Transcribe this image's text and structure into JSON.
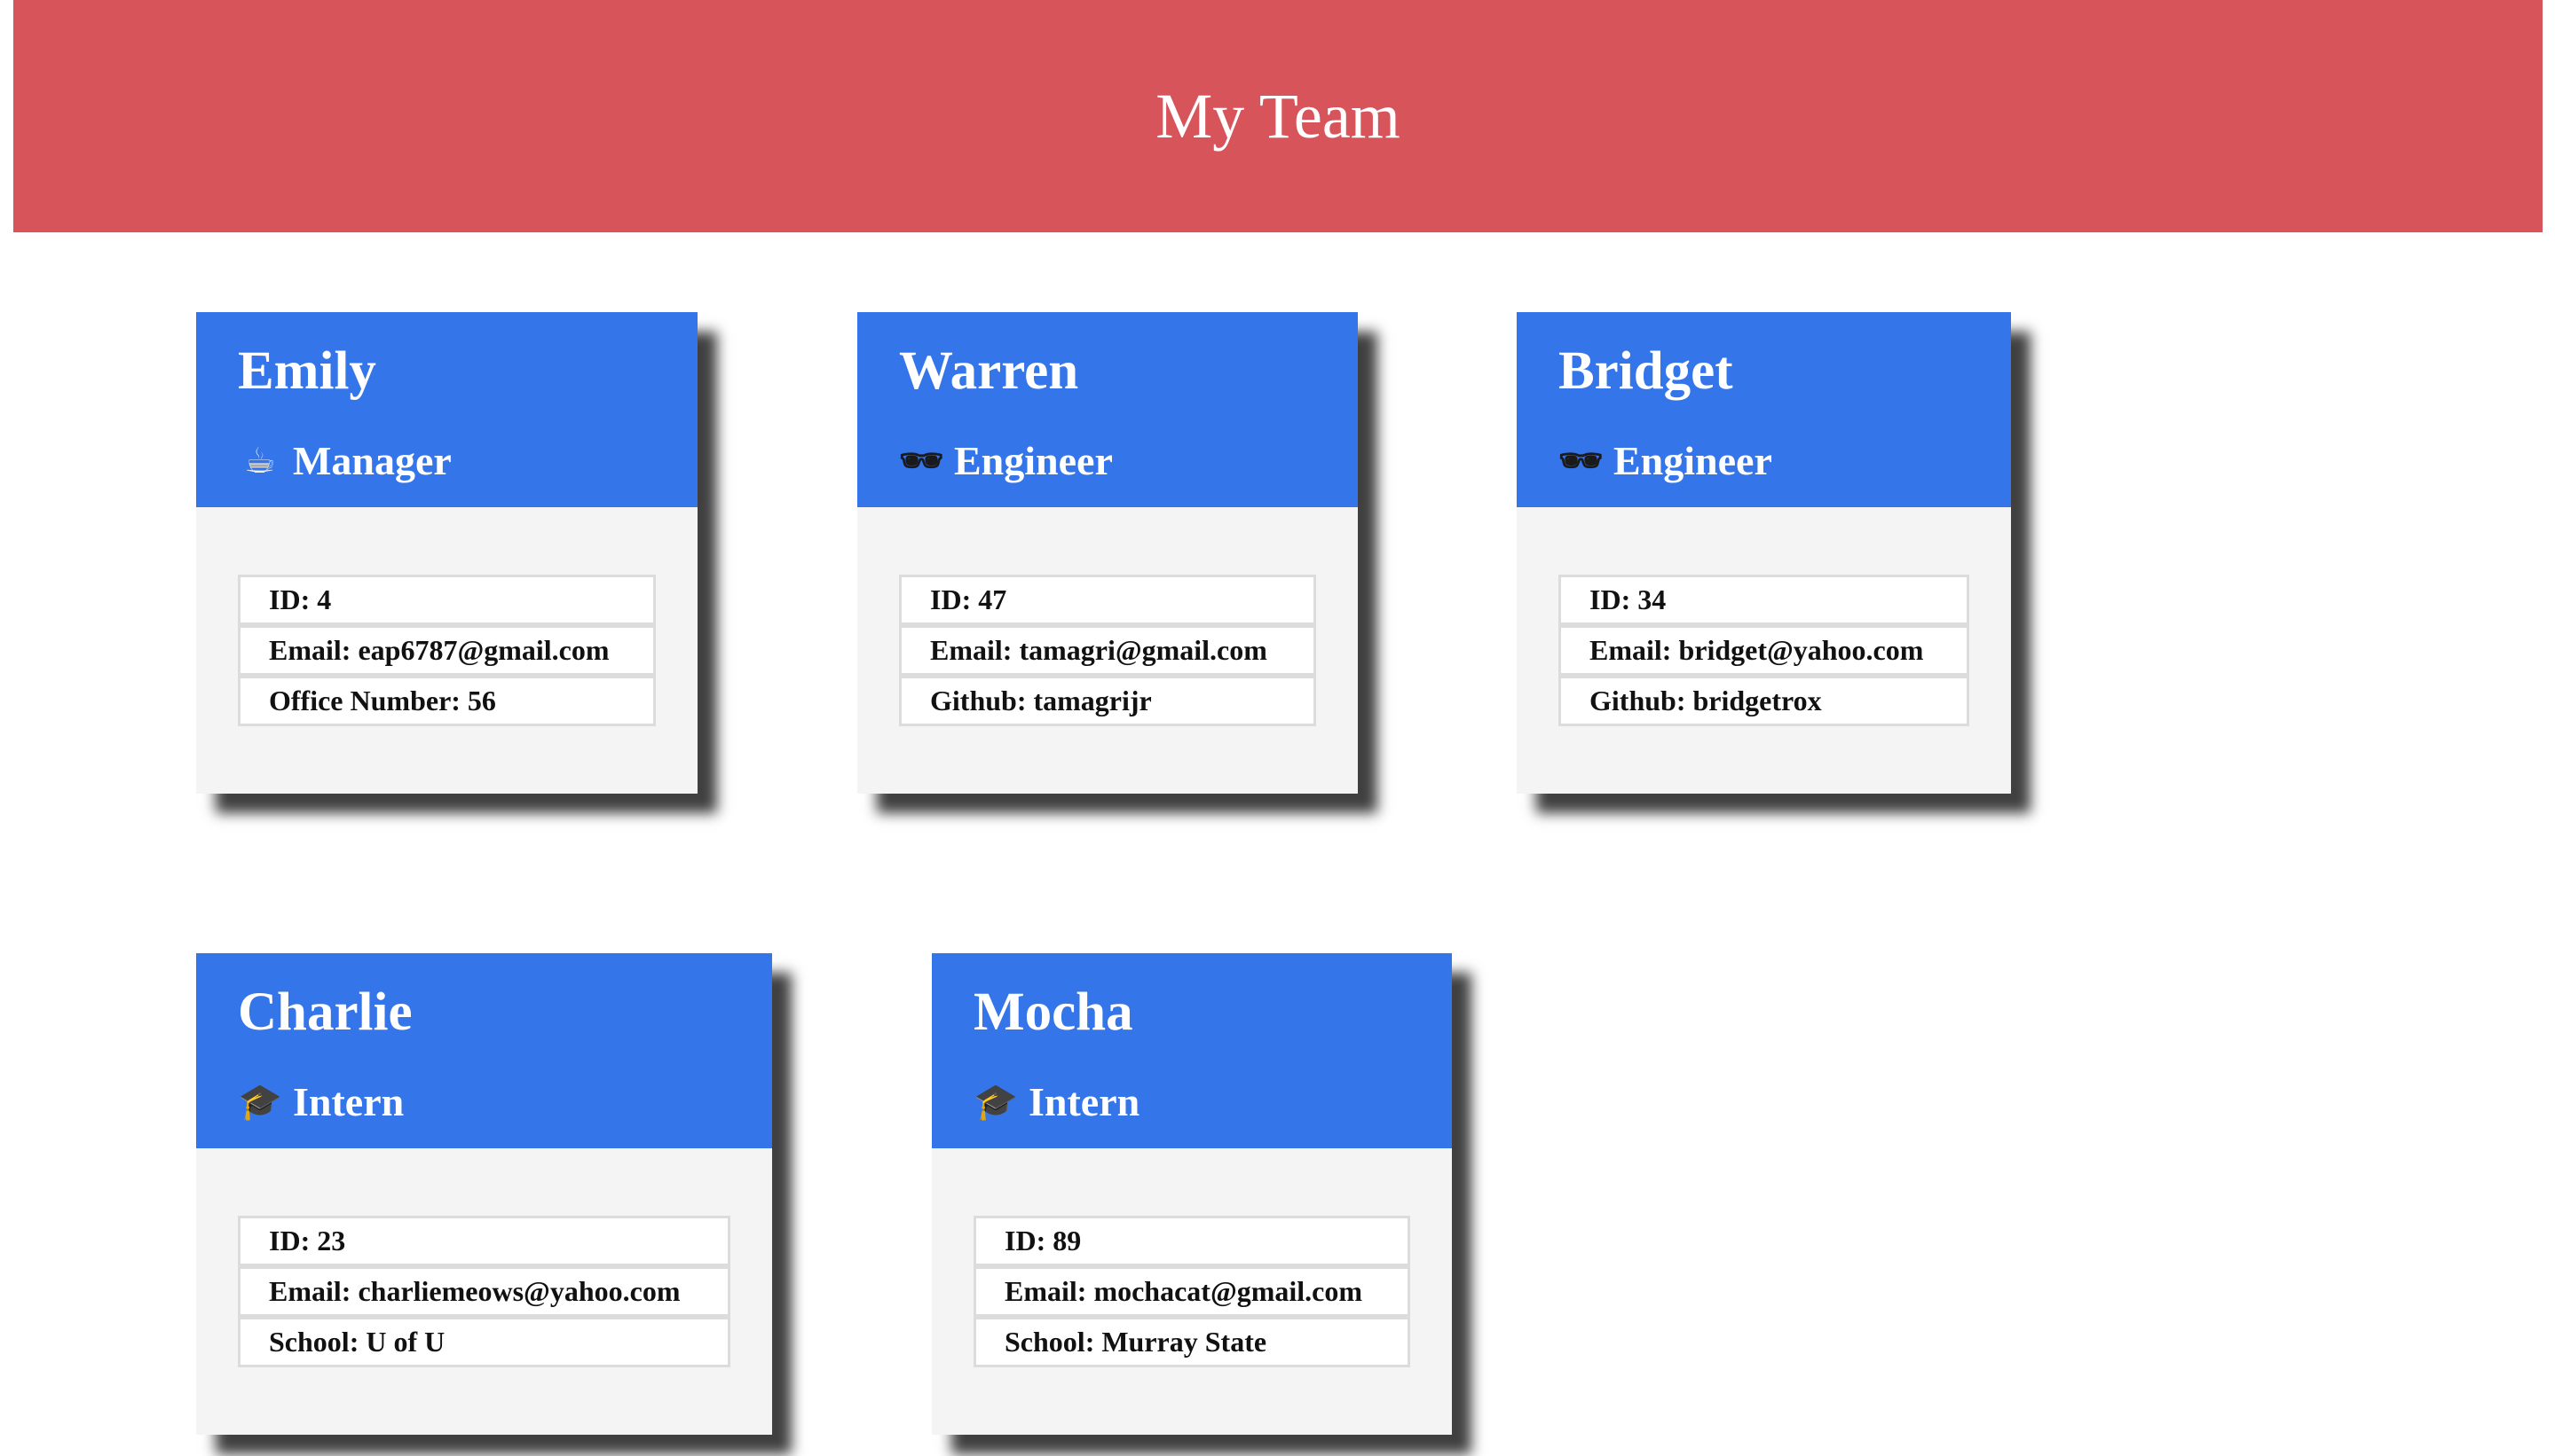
{
  "header": {
    "title": "My Team"
  },
  "team": [
    {
      "name": "Emily",
      "role": "Manager",
      "icon": "coffee-icon",
      "glyph": "☕",
      "details": [
        "ID: 4",
        "Email: eap6787@gmail.com",
        "Office Number: 56"
      ]
    },
    {
      "name": "Warren",
      "role": "Engineer",
      "icon": "sunglasses-icon",
      "glyph": "🕶",
      "details": [
        "ID: 47",
        "Email: tamagri@gmail.com",
        "Github: tamagrijr"
      ]
    },
    {
      "name": "Bridget",
      "role": "Engineer",
      "icon": "sunglasses-icon",
      "glyph": "🕶",
      "details": [
        "ID: 34",
        "Email: bridget@yahoo.com",
        "Github: bridgetrox"
      ]
    },
    {
      "name": "Charlie",
      "role": "Intern",
      "icon": "graduation-cap-icon",
      "glyph": "🎓",
      "details": [
        "ID: 23",
        "Email: charliemeows@yahoo.com",
        "School: U of U"
      ]
    },
    {
      "name": "Mocha",
      "role": "Intern",
      "icon": "graduation-cap-icon",
      "glyph": "🎓",
      "details": [
        "ID: 89",
        "Email: mochacat@gmail.com",
        "School: Murray State"
      ]
    }
  ],
  "colors": {
    "banner": "#d8545b",
    "card_header": "#3475ea",
    "card_body": "#f4f4f4"
  }
}
